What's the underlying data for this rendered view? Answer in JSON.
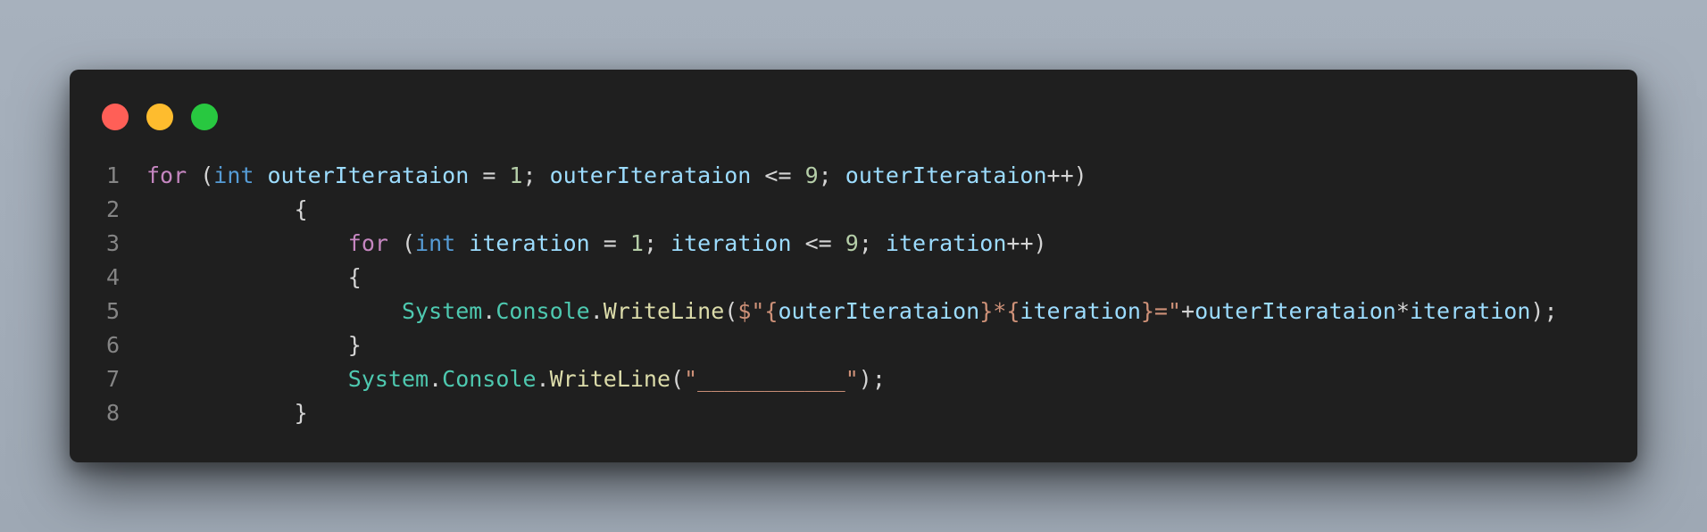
{
  "window": {
    "controls": [
      {
        "name": "close",
        "color": "#ff5f57"
      },
      {
        "name": "minimize",
        "color": "#febc2e"
      },
      {
        "name": "maximize",
        "color": "#28c840"
      }
    ]
  },
  "code": {
    "lines": [
      {
        "number": "1",
        "indent": "",
        "tokens": [
          {
            "text": "for",
            "kind": "kw"
          },
          {
            "text": " (",
            "kind": "op"
          },
          {
            "text": "int",
            "kind": "ty"
          },
          {
            "text": " ",
            "kind": "op"
          },
          {
            "text": "outerIterataion",
            "kind": "var"
          },
          {
            "text": " = ",
            "kind": "op"
          },
          {
            "text": "1",
            "kind": "num"
          },
          {
            "text": "; ",
            "kind": "op"
          },
          {
            "text": "outerIterataion",
            "kind": "var"
          },
          {
            "text": " <= ",
            "kind": "op"
          },
          {
            "text": "9",
            "kind": "num"
          },
          {
            "text": "; ",
            "kind": "op"
          },
          {
            "text": "outerIterataion",
            "kind": "var"
          },
          {
            "text": "++)",
            "kind": "op"
          }
        ]
      },
      {
        "number": "2",
        "indent": "           ",
        "tokens": [
          {
            "text": "{",
            "kind": "op"
          }
        ]
      },
      {
        "number": "3",
        "indent": "               ",
        "tokens": [
          {
            "text": "for",
            "kind": "kw"
          },
          {
            "text": " (",
            "kind": "op"
          },
          {
            "text": "int",
            "kind": "ty"
          },
          {
            "text": " ",
            "kind": "op"
          },
          {
            "text": "iteration",
            "kind": "var"
          },
          {
            "text": " = ",
            "kind": "op"
          },
          {
            "text": "1",
            "kind": "num"
          },
          {
            "text": "; ",
            "kind": "op"
          },
          {
            "text": "iteration",
            "kind": "var"
          },
          {
            "text": " <= ",
            "kind": "op"
          },
          {
            "text": "9",
            "kind": "num"
          },
          {
            "text": "; ",
            "kind": "op"
          },
          {
            "text": "iteration",
            "kind": "var"
          },
          {
            "text": "++)",
            "kind": "op"
          }
        ]
      },
      {
        "number": "4",
        "indent": "               ",
        "tokens": [
          {
            "text": "{",
            "kind": "op"
          }
        ]
      },
      {
        "number": "5",
        "indent": "                   ",
        "tokens": [
          {
            "text": "System",
            "kind": "cls"
          },
          {
            "text": ".",
            "kind": "op"
          },
          {
            "text": "Console",
            "kind": "cls"
          },
          {
            "text": ".",
            "kind": "op"
          },
          {
            "text": "WriteLine",
            "kind": "fn"
          },
          {
            "text": "(",
            "kind": "op"
          },
          {
            "text": "$\"{",
            "kind": "str"
          },
          {
            "text": "outerIterataion",
            "kind": "var"
          },
          {
            "text": "}*{",
            "kind": "str"
          },
          {
            "text": "iteration",
            "kind": "var"
          },
          {
            "text": "}=\"",
            "kind": "str"
          },
          {
            "text": "+",
            "kind": "op"
          },
          {
            "text": "outerIterataion",
            "kind": "var"
          },
          {
            "text": "*",
            "kind": "op"
          },
          {
            "text": "iteration",
            "kind": "var"
          },
          {
            "text": ");",
            "kind": "op"
          }
        ]
      },
      {
        "number": "6",
        "indent": "               ",
        "tokens": [
          {
            "text": "}",
            "kind": "op"
          }
        ]
      },
      {
        "number": "7",
        "indent": "               ",
        "tokens": [
          {
            "text": "System",
            "kind": "cls"
          },
          {
            "text": ".",
            "kind": "op"
          },
          {
            "text": "Console",
            "kind": "cls"
          },
          {
            "text": ".",
            "kind": "op"
          },
          {
            "text": "WriteLine",
            "kind": "fn"
          },
          {
            "text": "(",
            "kind": "op"
          },
          {
            "text": "\"___________\"",
            "kind": "str"
          },
          {
            "text": ");",
            "kind": "op"
          }
        ]
      },
      {
        "number": "8",
        "indent": "           ",
        "tokens": [
          {
            "text": "}",
            "kind": "op"
          }
        ]
      }
    ]
  }
}
